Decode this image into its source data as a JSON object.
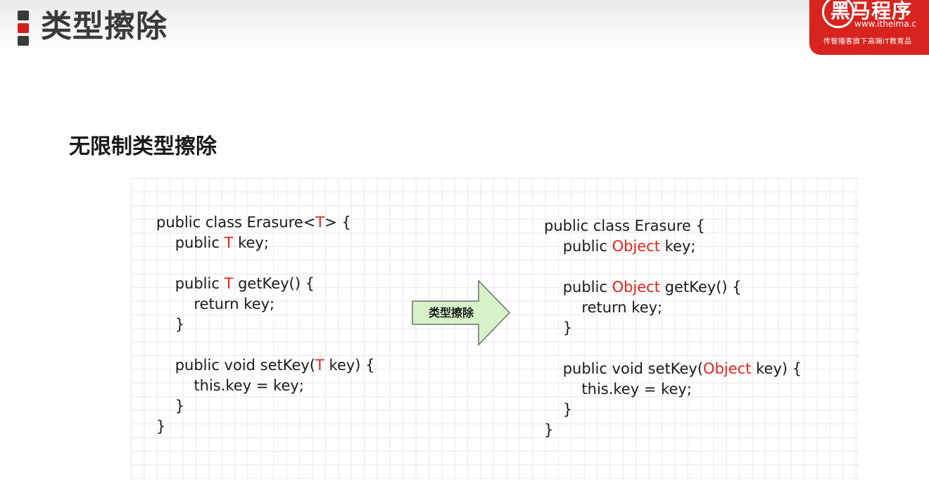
{
  "header": {
    "title": "类型擦除"
  },
  "brand": {
    "name": "黑马程序",
    "url": "www.itheima.c",
    "slogan": "传智播客旗下高端IT教育品"
  },
  "section": {
    "title": "无限制类型擦除"
  },
  "diagram": {
    "arrow_label": "类型擦除",
    "colors": {
      "highlight": "#e8231e",
      "arrow_fill": "#d6f2c8",
      "arrow_stroke": "#6f6f6f",
      "grid": "#e7e7e7"
    },
    "left_code": [
      [
        {
          "t": "public class Erasure<"
        },
        {
          "t": "T",
          "red": true
        },
        {
          "t": "> {"
        }
      ],
      [
        {
          "t": "    public "
        },
        {
          "t": "T",
          "red": true
        },
        {
          "t": " key;"
        }
      ],
      [],
      [
        {
          "t": "    public "
        },
        {
          "t": "T",
          "red": true
        },
        {
          "t": " getKey() {"
        }
      ],
      [
        {
          "t": "        return key;"
        }
      ],
      [
        {
          "t": "    }"
        }
      ],
      [],
      [
        {
          "t": "    public void setKey("
        },
        {
          "t": "T",
          "red": true
        },
        {
          "t": " key) {"
        }
      ],
      [
        {
          "t": "        this.key = key;"
        }
      ],
      [
        {
          "t": "    }"
        }
      ],
      [
        {
          "t": "}"
        }
      ]
    ],
    "right_code": [
      [
        {
          "t": "public class Erasure {"
        }
      ],
      [
        {
          "t": "    public "
        },
        {
          "t": "Object",
          "red": true
        },
        {
          "t": " key;"
        }
      ],
      [],
      [
        {
          "t": "    public "
        },
        {
          "t": "Object",
          "red": true
        },
        {
          "t": " getKey() {"
        }
      ],
      [
        {
          "t": "        return key;"
        }
      ],
      [
        {
          "t": "    }"
        }
      ],
      [],
      [
        {
          "t": "    public void setKey("
        },
        {
          "t": "Object",
          "red": true
        },
        {
          "t": " key) {"
        }
      ],
      [
        {
          "t": "        this.key = key;"
        }
      ],
      [
        {
          "t": "    }"
        }
      ],
      [
        {
          "t": "}"
        }
      ]
    ]
  }
}
